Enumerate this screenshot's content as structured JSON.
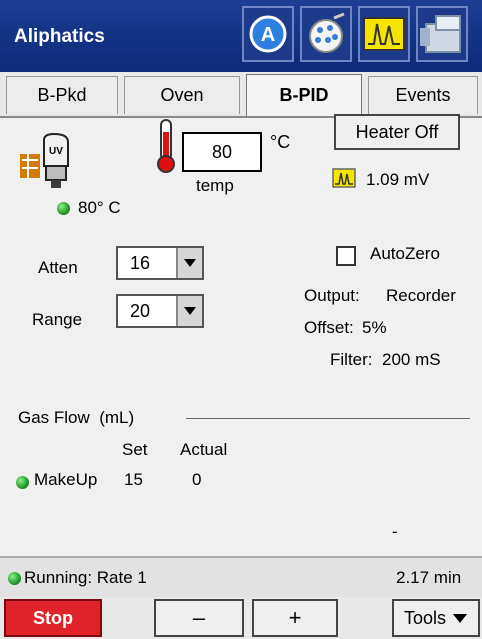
{
  "app_title": "Aliphatics",
  "toolbar_icons": [
    {
      "name": "autosampler-icon",
      "letter": "A"
    },
    {
      "name": "plate-icon"
    },
    {
      "name": "signal-icon"
    },
    {
      "name": "instrument-icon"
    }
  ],
  "tabs": [
    {
      "label": "B-Pkd",
      "active": false
    },
    {
      "label": "Oven",
      "active": false
    },
    {
      "label": "B-PID",
      "active": true
    },
    {
      "label": "Events",
      "active": false
    }
  ],
  "detector": {
    "lamp_label": "UV",
    "temp_value": "80",
    "temp_unit": "°C",
    "temp_caption": "temp",
    "actual_temp": "80° C",
    "heater_button": "Heater Off",
    "signal_value": "1.09 mV"
  },
  "settings": {
    "atten_label": "Atten",
    "atten_value": "16",
    "range_label": "Range",
    "range_value": "20",
    "autozero_label": "AutoZero",
    "autozero_checked": false,
    "output_label": "Output:",
    "output_value": "Recorder",
    "offset_label": "Offset:",
    "offset_value": "5%",
    "filter_label": "Filter:",
    "filter_value": "200 mS"
  },
  "gas_flow": {
    "title": "Gas Flow  (mL)",
    "set_header": "Set",
    "actual_header": "Actual",
    "rows": [
      {
        "name": "MakeUp",
        "set": "15",
        "actual": "0"
      }
    ],
    "dash": "-"
  },
  "status": {
    "text": "Running: Rate 1",
    "time": "2.17 min"
  },
  "bottom": {
    "stop": "Stop",
    "minus": "–",
    "plus": "+",
    "tools": "Tools"
  },
  "colors": {
    "titlebar": "#0b2a78",
    "stop": "#e0222a",
    "status_dot": "#1f9a2a"
  }
}
